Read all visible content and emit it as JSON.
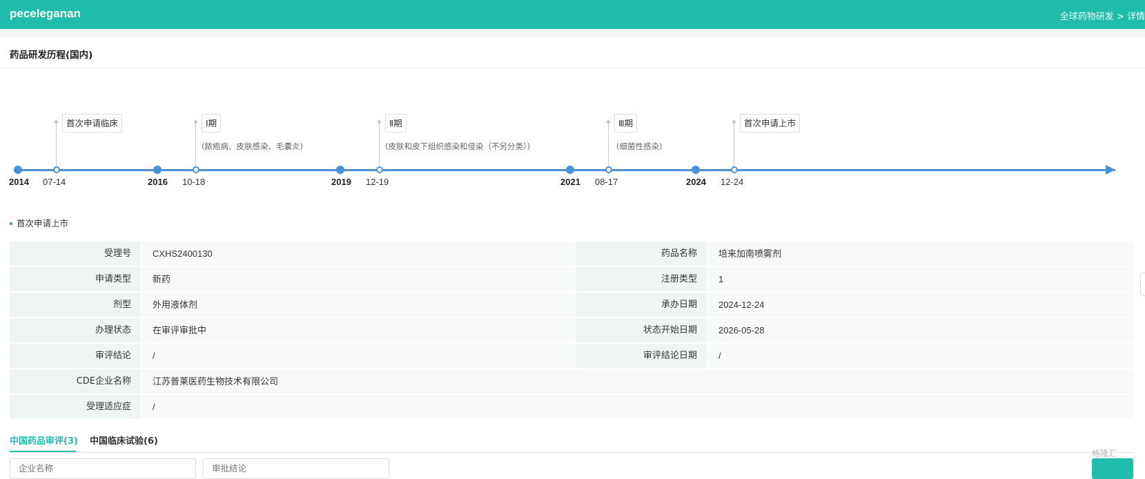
{
  "header": {
    "app_title": "peceleganan",
    "breadcrumb_parent": "全球药物研发",
    "breadcrumb_sep": ">",
    "breadcrumb_current": "详情"
  },
  "section": {
    "title": "药品研发历程(国内)"
  },
  "timeline": {
    "years": [
      "2014",
      "2016",
      "2019",
      "2021",
      "2024"
    ],
    "events": [
      {
        "date": "07-14",
        "label": "首次申请临床",
        "note": ""
      },
      {
        "date": "10-18",
        "label": "Ⅰ期",
        "note": "(脓疱病、皮肤感染、毛囊炎)"
      },
      {
        "date": "12-19",
        "label": "Ⅱ期",
        "note": "(皮肤和皮下组织感染和侵染（不另分类）)"
      },
      {
        "date": "08-17",
        "label": "Ⅲ期",
        "note": "(细菌性感染)"
      },
      {
        "date": "12-24",
        "label": "首次申请上市",
        "note": ""
      }
    ]
  },
  "subheading": "首次申请上市",
  "details": {
    "accept_no_label": "受理号",
    "accept_no": "CXHS2400130",
    "drug_name_label": "药品名称",
    "drug_name": "培来加南喷雾剂",
    "apply_type_label": "申请类型",
    "apply_type": "新药",
    "reg_type_label": "注册类型",
    "reg_type": "1",
    "dosage_label": "剂型",
    "dosage": "外用液体剂",
    "undertake_date_label": "承办日期",
    "undertake_date": "2024-12-24",
    "status_label": "办理状态",
    "status": "在审评审批中",
    "status_start_label": "状态开始日期",
    "status_start": "2026-05-28",
    "conclusion_label": "审评结论",
    "conclusion": "/",
    "conclusion_date_label": "审评结论日期",
    "conclusion_date": "/",
    "company_label": "CDE企业名称",
    "company": "江苏普莱医药生物技术有限公司",
    "indication_label": "受理适应症",
    "indication": "/"
  },
  "tabs": [
    {
      "label": "中国药品审评(3)"
    },
    {
      "label": "中国临床试验(6)"
    }
  ],
  "filters": {
    "company_placeholder": "企业名称",
    "approval_placeholder": "审批结论"
  },
  "watermark": "格隆汇"
}
